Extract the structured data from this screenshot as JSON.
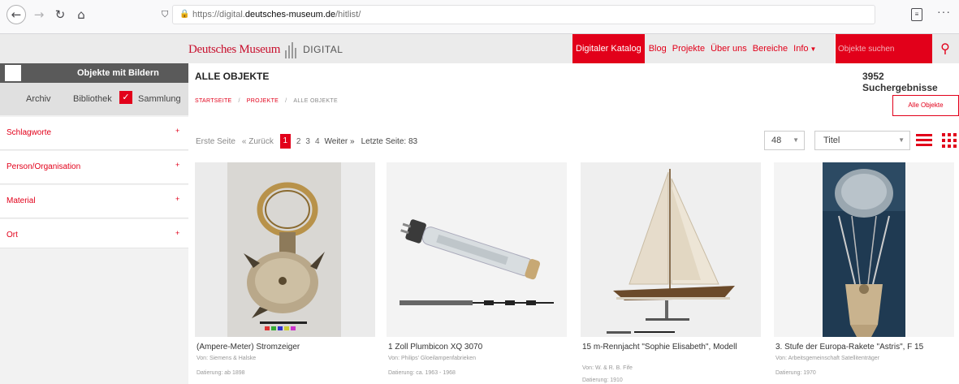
{
  "browser": {
    "url_prefix": "https://digital.",
    "url_domain": "deutsches-museum.de",
    "url_path": "/hitlist/",
    "back_icon": "back-arrow-icon",
    "forward_icon": "forward-arrow-icon",
    "reload_icon": "reload-icon",
    "home_icon": "home-icon",
    "more_label": "···"
  },
  "header": {
    "logo_text": "Deutsches Museum",
    "logo_suffix": "DIGITAL",
    "nav_active": "Digitaler Katalog",
    "nav": [
      "Blog",
      "Projekte",
      "Über uns",
      "Bereiche",
      "Info"
    ],
    "search_placeholder": "Objekte suchen",
    "accent_color": "#e2001a"
  },
  "sidebar": {
    "filter_label": "Objekte mit Bildern",
    "types": [
      "Archiv",
      "Bibliothek",
      "Sammlung"
    ],
    "facets": [
      "Schlagworte",
      "Person/Organisation",
      "Material",
      "Ort"
    ]
  },
  "main": {
    "heading": "ALLE OBJEKTE",
    "result_count": "3952 Suchergebnisse",
    "breadcrumb": [
      "STARTSEITE",
      "PROJEKTE",
      "ALLE OBJEKTE"
    ],
    "all_objects_button": "Alle Objekte",
    "pager": {
      "first": "Erste Seite",
      "prev": "« Zurück",
      "current": "1",
      "pages": [
        "2",
        "3",
        "4"
      ],
      "next": "Weiter »",
      "last": "Letzte Seite: 83"
    },
    "per_page": "48",
    "sort": "Titel"
  },
  "cards": [
    {
      "title": "(Ampere-Meter) Stromzeiger",
      "by": "Von: Siemens & Halske",
      "date": "Datierung: ab 1898"
    },
    {
      "title": "1 Zoll Plumbicon XQ 3070",
      "by": "Von: Philips' Gloeilampenfabrieken",
      "date": "Datierung: ca. 1963 - 1968"
    },
    {
      "title": "15 m-Rennjacht \"Sophie Elisabeth\", Modell",
      "by": "Von: W. & R. B. Fife",
      "date": "Datierung: 1910"
    },
    {
      "title": "3. Stufe der Europa-Rakete \"Astris\", F 15",
      "by": "Von: Arbeitsgemeinschaft Satellitenträger",
      "date": "Datierung: 1970"
    }
  ]
}
